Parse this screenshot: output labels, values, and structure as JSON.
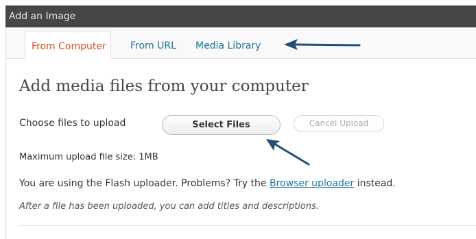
{
  "dialog": {
    "title": "Add an Image"
  },
  "tabs": [
    {
      "label": "From Computer",
      "active": true
    },
    {
      "label": "From URL",
      "active": false
    },
    {
      "label": "Media Library",
      "active": false
    }
  ],
  "main": {
    "heading": "Add media files from your computer",
    "choose_label": "Choose files to upload",
    "select_button": "Select Files",
    "cancel_button": "Cancel Upload",
    "max_size": "Maximum upload file size: 1MB",
    "flash_prefix": "You are using the Flash uploader.  Problems?  Try the ",
    "flash_link": "Browser uploader",
    "flash_suffix": " instead.",
    "after_upload": "After a file has been uploaded, you can add titles and descriptions."
  },
  "colors": {
    "titlebar": "#464646",
    "link": "#21759b",
    "active_tab": "#d54e21",
    "annotation_arrow": "#1f4e79"
  },
  "icons": {
    "tab_arrow": "left-arrow-annotation",
    "button_arrow": "up-left-arrow-annotation"
  }
}
